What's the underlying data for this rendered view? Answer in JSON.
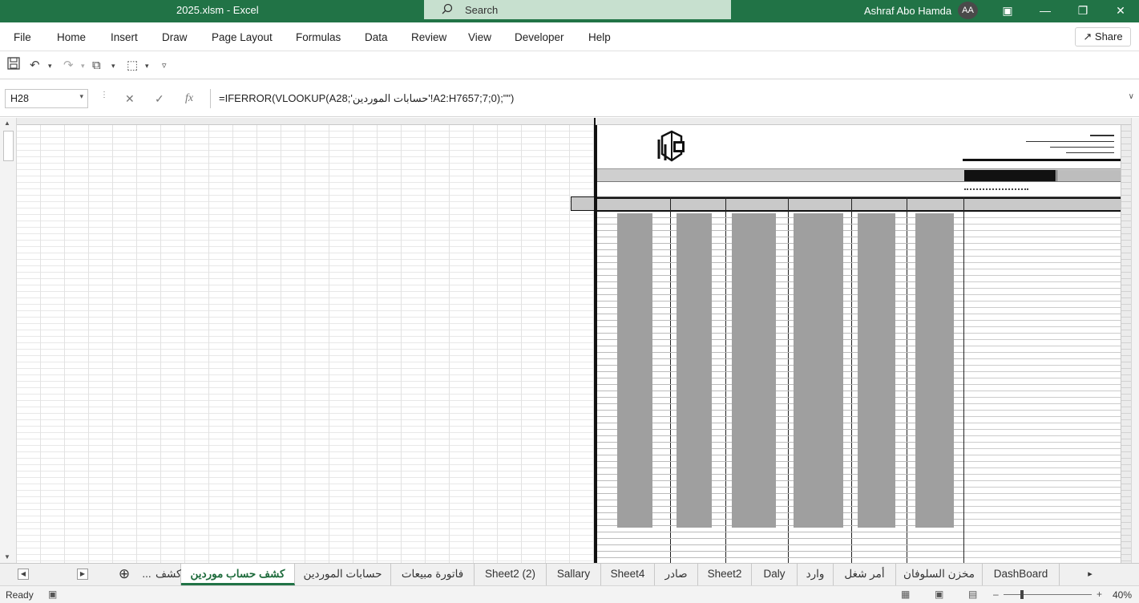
{
  "window": {
    "doc_title": "2025.xlsm - Excel",
    "search_placeholder": "Search",
    "user_name": "Ashraf Abo Hamda",
    "user_initials": "AA",
    "controls": {
      "ribbon_display": "▣",
      "minimize": "—",
      "restore": "❐",
      "close": "✕"
    }
  },
  "menu": {
    "items": [
      "File",
      "Home",
      "Insert",
      "Draw",
      "Page Layout",
      "Formulas",
      "Data",
      "Review",
      "View",
      "Developer",
      "Help"
    ],
    "share_label": "Share"
  },
  "qat": {
    "save": "💾",
    "undo": "↶",
    "undo_dd": "▾",
    "redo": "↷",
    "redo_dd": "▾",
    "format": "⧉",
    "format_dd": "▾",
    "shapes": "⬚",
    "shapes_dd": "▾",
    "customize": "▿"
  },
  "formula_bar": {
    "name_box": "H28",
    "name_box_dd": "▾",
    "cancel": "✕",
    "enter": "✓",
    "fx": "fx",
    "formula": "=IFERROR(VLOOKUP(A28;'حسابات الموردين'!A2:H7657;7;0);\"\")",
    "expand": "∨"
  },
  "sheet_tabs": {
    "tabs": [
      {
        "label": "كشف",
        "active": false
      },
      {
        "label": "كشف حساب موردين",
        "active": true
      },
      {
        "label": "حسابات الموردين",
        "active": false
      },
      {
        "label": "فاتورة مبيعات",
        "active": false
      },
      {
        "label": "Sheet2 (2)",
        "active": false
      },
      {
        "label": "Sallary",
        "active": false
      },
      {
        "label": "Sheet4",
        "active": false
      },
      {
        "label": "صادر",
        "active": false
      },
      {
        "label": "Sheet2",
        "active": false
      },
      {
        "label": "Daly",
        "active": false
      },
      {
        "label": "وارد",
        "active": false
      },
      {
        "label": "أمر شغل",
        "active": false
      },
      {
        "label": "مخزن السلوفان",
        "active": false
      },
      {
        "label": "DashBoard",
        "active": false
      }
    ],
    "add_sheet": "⊕",
    "more": "...",
    "nav_prev": "◀",
    "nav_next": "▶",
    "scroll_right": "▸"
  },
  "status": {
    "ready": "Ready",
    "zoom": "40%"
  },
  "icons": {
    "search": "search-icon",
    "save": "save-icon",
    "undo": "undo-icon",
    "redo": "redo-icon",
    "share": "share-icon"
  },
  "colors": {
    "excel_green": "#217346",
    "search_bg": "#c7e0cf",
    "report_shade": "#9f9f9f"
  }
}
